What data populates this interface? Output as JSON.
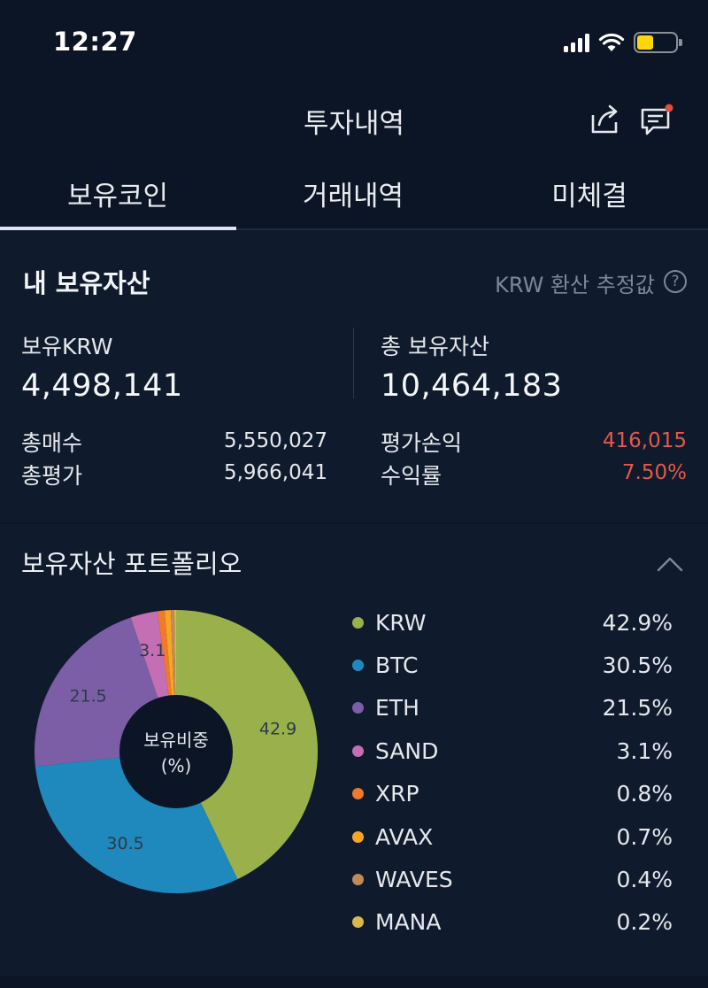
{
  "status_bar": {
    "time": "12:27"
  },
  "header": {
    "title": "투자내역",
    "share_icon": "share-icon",
    "chat_icon": "chat-icon"
  },
  "tabs": [
    {
      "label": "보유코인",
      "active": true
    },
    {
      "label": "거래내역",
      "active": false
    },
    {
      "label": "미체결",
      "active": false
    }
  ],
  "assets": {
    "title": "내 보유자산",
    "note": "KRW 환산 추정값",
    "help_glyph": "?",
    "krw_label": "보유KRW",
    "krw_value": "4,498,141",
    "total_label": "총 보유자산",
    "total_value": "10,464,183",
    "buy_label": "총매수",
    "buy_value": "5,550,027",
    "eval_label": "총평가",
    "eval_value": "5,966,041",
    "pnl_label": "평가손익",
    "pnl_value": "416,015",
    "roi_label": "수익률",
    "roi_value": "7.50%"
  },
  "portfolio": {
    "title": "보유자산 포트폴리오",
    "center_label_1": "보유비중",
    "center_label_2": "(%)",
    "items": [
      {
        "name": "KRW",
        "pct": "42.9%",
        "value": 42.9,
        "color": "#9ab04a",
        "slice_label": "42.9"
      },
      {
        "name": "BTC",
        "pct": "30.5%",
        "value": 30.5,
        "color": "#1f89bd",
        "slice_label": "30.5"
      },
      {
        "name": "ETH",
        "pct": "21.5%",
        "value": 21.5,
        "color": "#7b5ea6",
        "slice_label": "21.5"
      },
      {
        "name": "SAND",
        "pct": "3.1%",
        "value": 3.1,
        "color": "#c46fb3",
        "slice_label": "3.1"
      },
      {
        "name": "XRP",
        "pct": "0.8%",
        "value": 0.8,
        "color": "#f0792a",
        "slice_label": ""
      },
      {
        "name": "AVAX",
        "pct": "0.7%",
        "value": 0.7,
        "color": "#f6a623",
        "slice_label": ""
      },
      {
        "name": "WAVES",
        "pct": "0.4%",
        "value": 0.4,
        "color": "#c08a5a",
        "slice_label": ""
      },
      {
        "name": "MANA",
        "pct": "0.2%",
        "value": 0.2,
        "color": "#d9b84d",
        "slice_label": ""
      }
    ]
  }
}
